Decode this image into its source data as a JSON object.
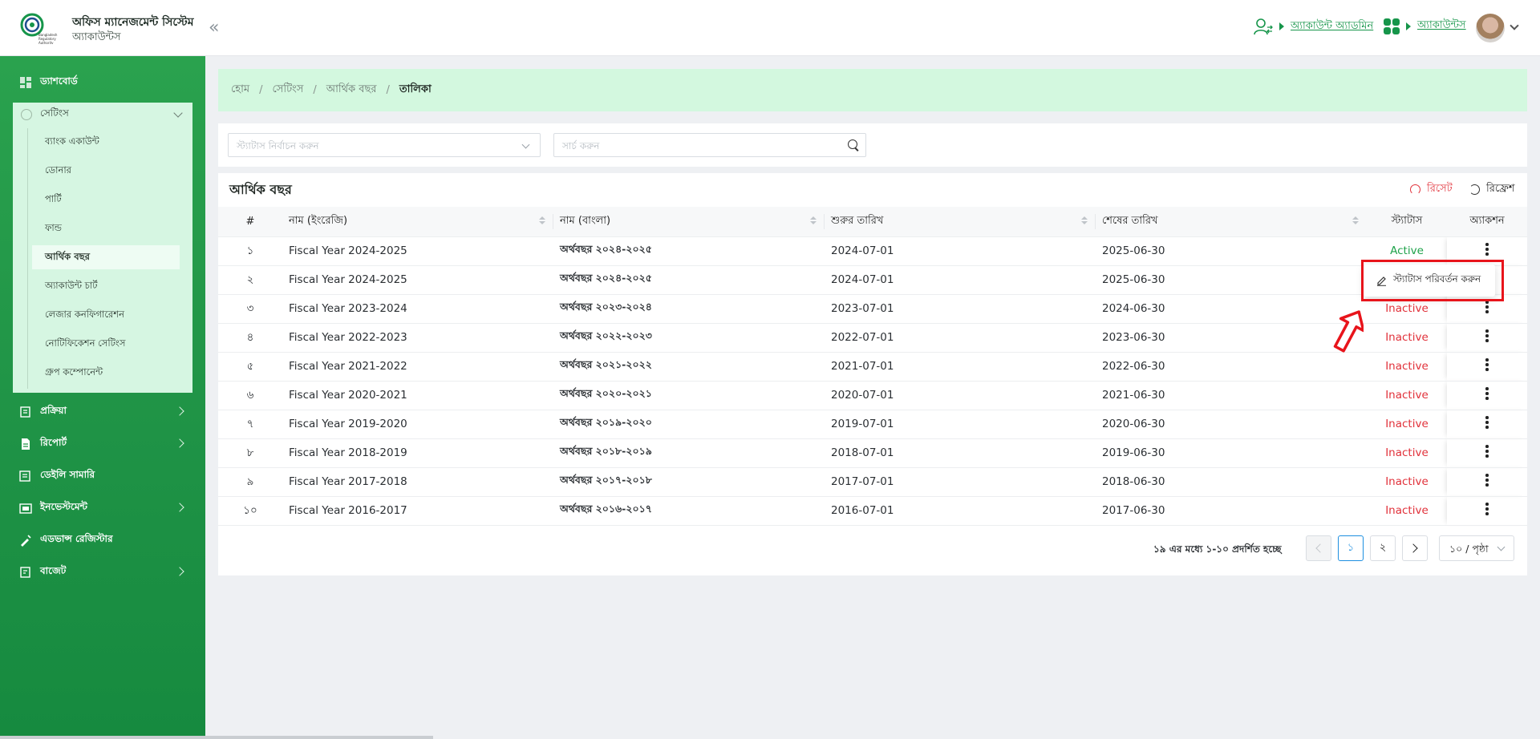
{
  "header": {
    "app_title": "অফিস ম্যানেজমেন্ট সিস্টেম",
    "app_subtitle": "অ্যাকাউন্টস",
    "user_role": "অ্যাকাউন্ট অ্যাডমিন",
    "module": "অ্যাকাউন্টস",
    "logo_text": "Bangladesh Regulatory Authority"
  },
  "sidebar": {
    "items": [
      {
        "label": "ড্যাশবোর্ড",
        "icon": "dashboard-icon"
      },
      {
        "label": "প্রক্রিয়া",
        "icon": "process-icon"
      },
      {
        "label": "রিপোর্ট",
        "icon": "report-icon"
      },
      {
        "label": "ডেইলি সামারি",
        "icon": "summary-icon"
      },
      {
        "label": "ইনভেস্টমেন্ট",
        "icon": "investment-icon"
      },
      {
        "label": "এডভান্স রেজিস্টার",
        "icon": "register-icon"
      },
      {
        "label": "বাজেট",
        "icon": "budget-icon"
      }
    ],
    "settings": {
      "label": "সেটিংস",
      "sub_items": [
        "ব্যাংক একাউন্ট",
        "ডোনার",
        "পার্টি",
        "ফান্ড",
        "আর্থিক বছর",
        "অ্যাকাউন্ট চার্ট",
        "লেজার কনফিগারেশন",
        "নোটিফিকেশন সেটিংস",
        "গ্রুপ কম্পোনেন্ট"
      ],
      "active": "আর্থিক বছর"
    }
  },
  "breadcrumb": [
    "হোম",
    "সেটিংস",
    "আর্থিক বছর",
    "তালিকা"
  ],
  "filters": {
    "status_placeholder": "স্ট্যাটাস নির্বাচন করুন",
    "search_placeholder": "সার্চ করুন"
  },
  "table": {
    "title": "আর্থিক বছর",
    "reset_label": "রিসেট",
    "refresh_label": "রিফ্রেশ",
    "columns": [
      "#",
      "নাম (ইংরেজি)",
      "নাম (বাংলা)",
      "শুরুর তারিখ",
      "শেষের তারিখ",
      "স্ট্যাটাস",
      "অ্যাকশন"
    ],
    "rows": [
      {
        "sl": "১",
        "name_en": "Fiscal Year 2024-2025",
        "name_bn": "অর্থবছর ২০২৪-২০২৫",
        "start": "2024-07-01",
        "end": "2025-06-30",
        "status": "Active"
      },
      {
        "sl": "২",
        "name_en": "Fiscal Year 2024-2025",
        "name_bn": "অর্থবছর ২০২৪-২০২৫",
        "start": "2024-07-01",
        "end": "2025-06-30",
        "status": ""
      },
      {
        "sl": "৩",
        "name_en": "Fiscal Year 2023-2024",
        "name_bn": "অর্থবছর ২০২৩-২০২৪",
        "start": "2023-07-01",
        "end": "2024-06-30",
        "status": "Inactive"
      },
      {
        "sl": "৪",
        "name_en": "Fiscal Year 2022-2023",
        "name_bn": "অর্থবছর ২০২২-২০২৩",
        "start": "2022-07-01",
        "end": "2023-06-30",
        "status": "Inactive"
      },
      {
        "sl": "৫",
        "name_en": "Fiscal Year 2021-2022",
        "name_bn": "অর্থবছর ২০২১-২০২২",
        "start": "2021-07-01",
        "end": "2022-06-30",
        "status": "Inactive"
      },
      {
        "sl": "৬",
        "name_en": "Fiscal Year 2020-2021",
        "name_bn": "অর্থবছর ২০২০-২০২১",
        "start": "2020-07-01",
        "end": "2021-06-30",
        "status": "Inactive"
      },
      {
        "sl": "৭",
        "name_en": "Fiscal Year 2019-2020",
        "name_bn": "অর্থবছর ২০১৯-২০২০",
        "start": "2019-07-01",
        "end": "2020-06-30",
        "status": "Inactive"
      },
      {
        "sl": "৮",
        "name_en": "Fiscal Year 2018-2019",
        "name_bn": "অর্থবছর ২০১৮-২০১৯",
        "start": "2018-07-01",
        "end": "2019-06-30",
        "status": "Inactive"
      },
      {
        "sl": "৯",
        "name_en": "Fiscal Year 2017-2018",
        "name_bn": "অর্থবছর ২০১৭-২০১৮",
        "start": "2017-07-01",
        "end": "2018-06-30",
        "status": "Inactive"
      },
      {
        "sl": "১০",
        "name_en": "Fiscal Year 2016-2017",
        "name_bn": "অর্থবছর ২০১৬-২০১৭",
        "start": "2016-07-01",
        "end": "2017-06-30",
        "status": "Inactive"
      }
    ]
  },
  "action_menu": {
    "change_status_label": "স্ট্যাটাস পরিবর্তন করুন"
  },
  "pagination": {
    "summary": "১৯ এর মধ্যে ১-১০ প্রদর্শিত হচ্ছে",
    "pages": [
      "১",
      "২"
    ],
    "current": "১",
    "page_size": "১০ / পৃষ্ঠা"
  },
  "colors": {
    "primary": "#1f9346",
    "active": "#1ea24a",
    "inactive": "#e1313a",
    "annotation": "#e8141b"
  }
}
